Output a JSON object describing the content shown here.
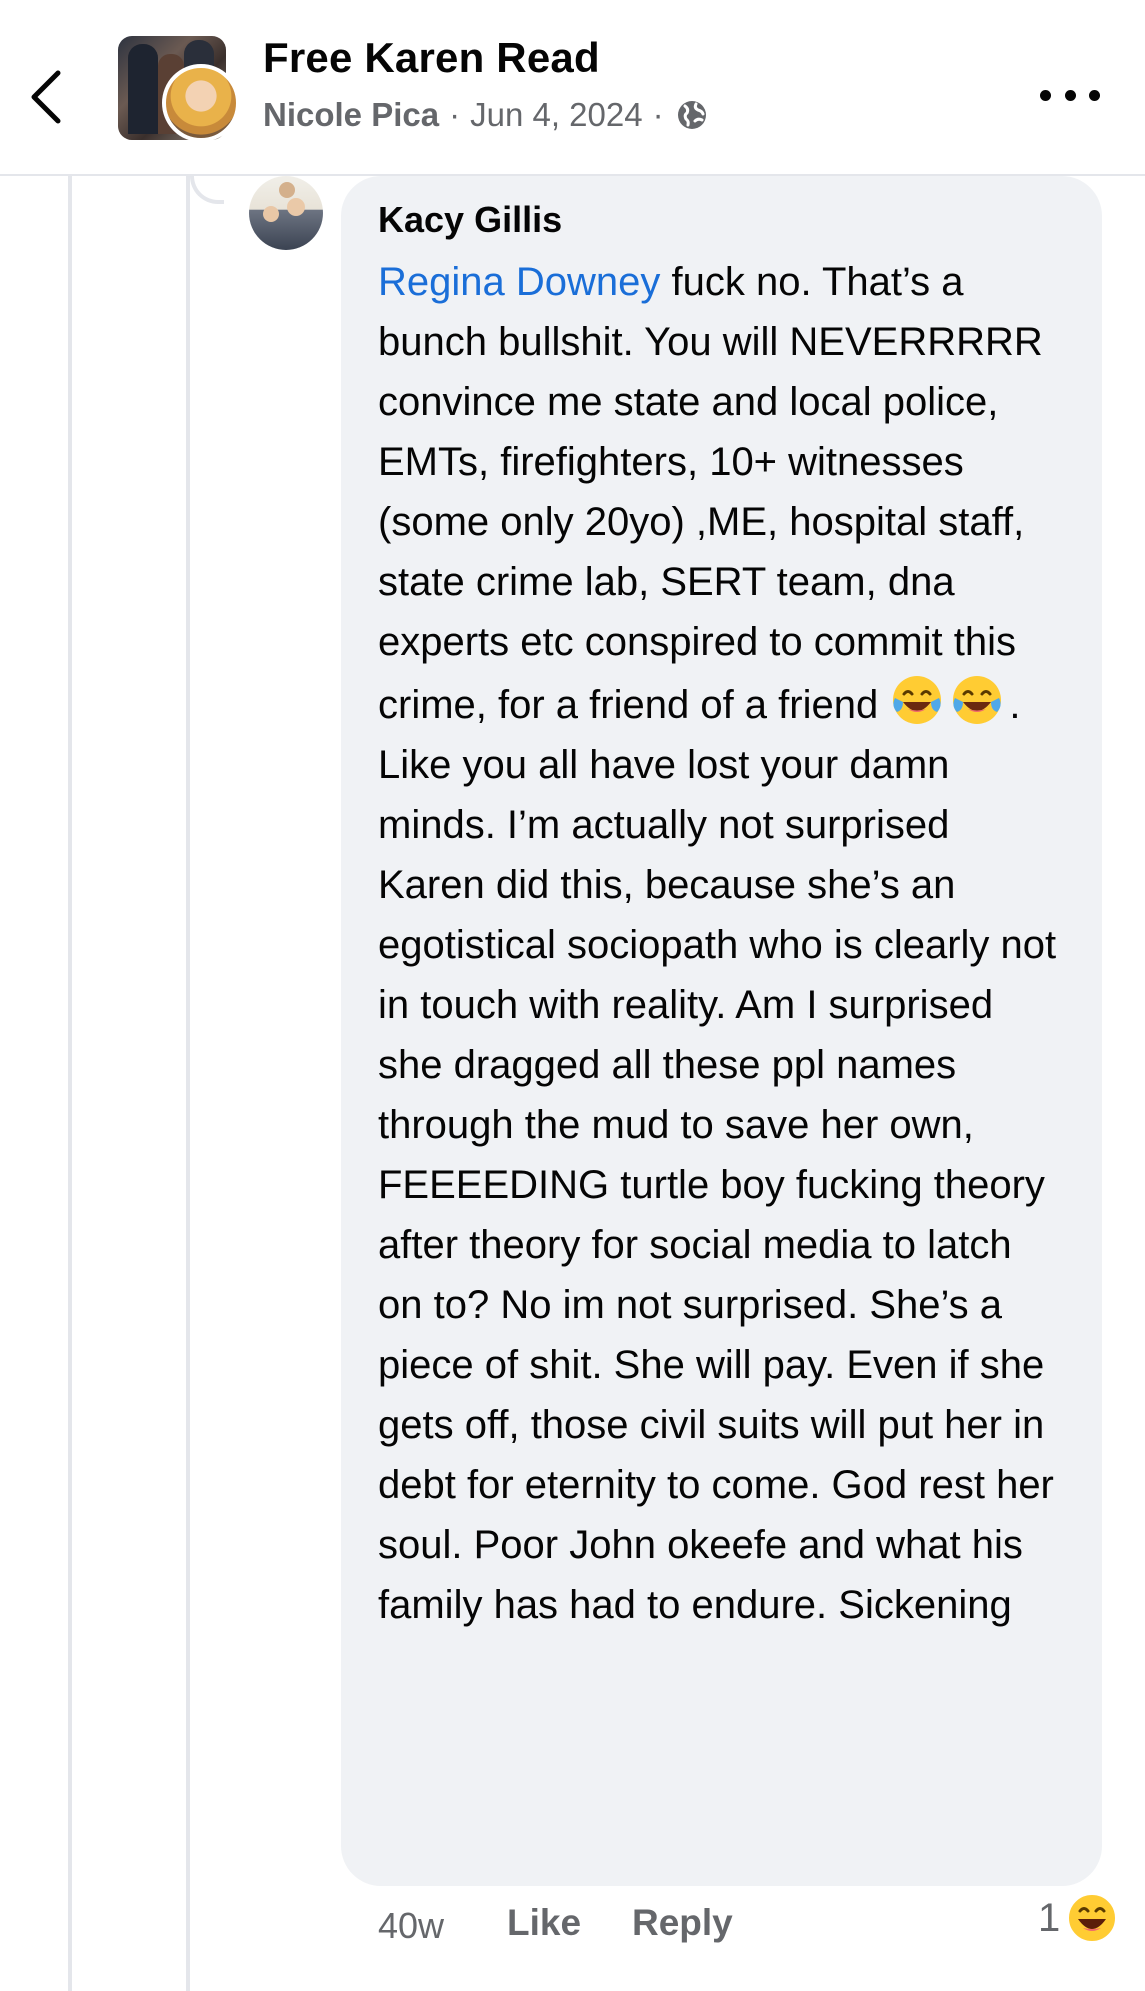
{
  "header": {
    "group_name": "Free Karen Read",
    "author": "Nicole Pica",
    "separator": "·",
    "date": "Jun 4, 2024",
    "privacy_icon": "globe-icon"
  },
  "comment": {
    "commenter": "Kacy Gillis",
    "mention": "Regina Downey",
    "text_part1": " fuck no. That’s a bunch bullshit. You will NEVERRRRR convince me state and local police, EMTs, firefighters, 10+ witnesses (some only 20yo) ,ME, hospital staff, state crime lab, SERT team, dna experts etc conspired to commit this crime, for a friend of a friend ",
    "emoji": "face-with-tears-of-joy",
    "text_part2": ". Like you all have lost your damn minds. I’m actually not surprised Karen did this, because she’s an egotistical sociopath who is clearly not in touch with reality. Am I surprised she dragged all these ppl names through the mud to save her own, FEEEEDING turtle boy fucking theory after theory for social media to latch on to? No im not surprised. She’s a piece of shit. She will pay. Even if she gets off, those civil suits will put her in debt for eternity to come. God rest her soul. Poor John okeefe and what his family has had to endure. Sickening"
  },
  "actions": {
    "time": "40w",
    "like": "Like",
    "reply": "Reply",
    "reaction_count": "1",
    "reaction_icon": "haha-reaction-icon"
  },
  "colors": {
    "mention": "#1a6ed8",
    "bubble": "#f0f2f5",
    "secondary_text": "#65676b"
  }
}
